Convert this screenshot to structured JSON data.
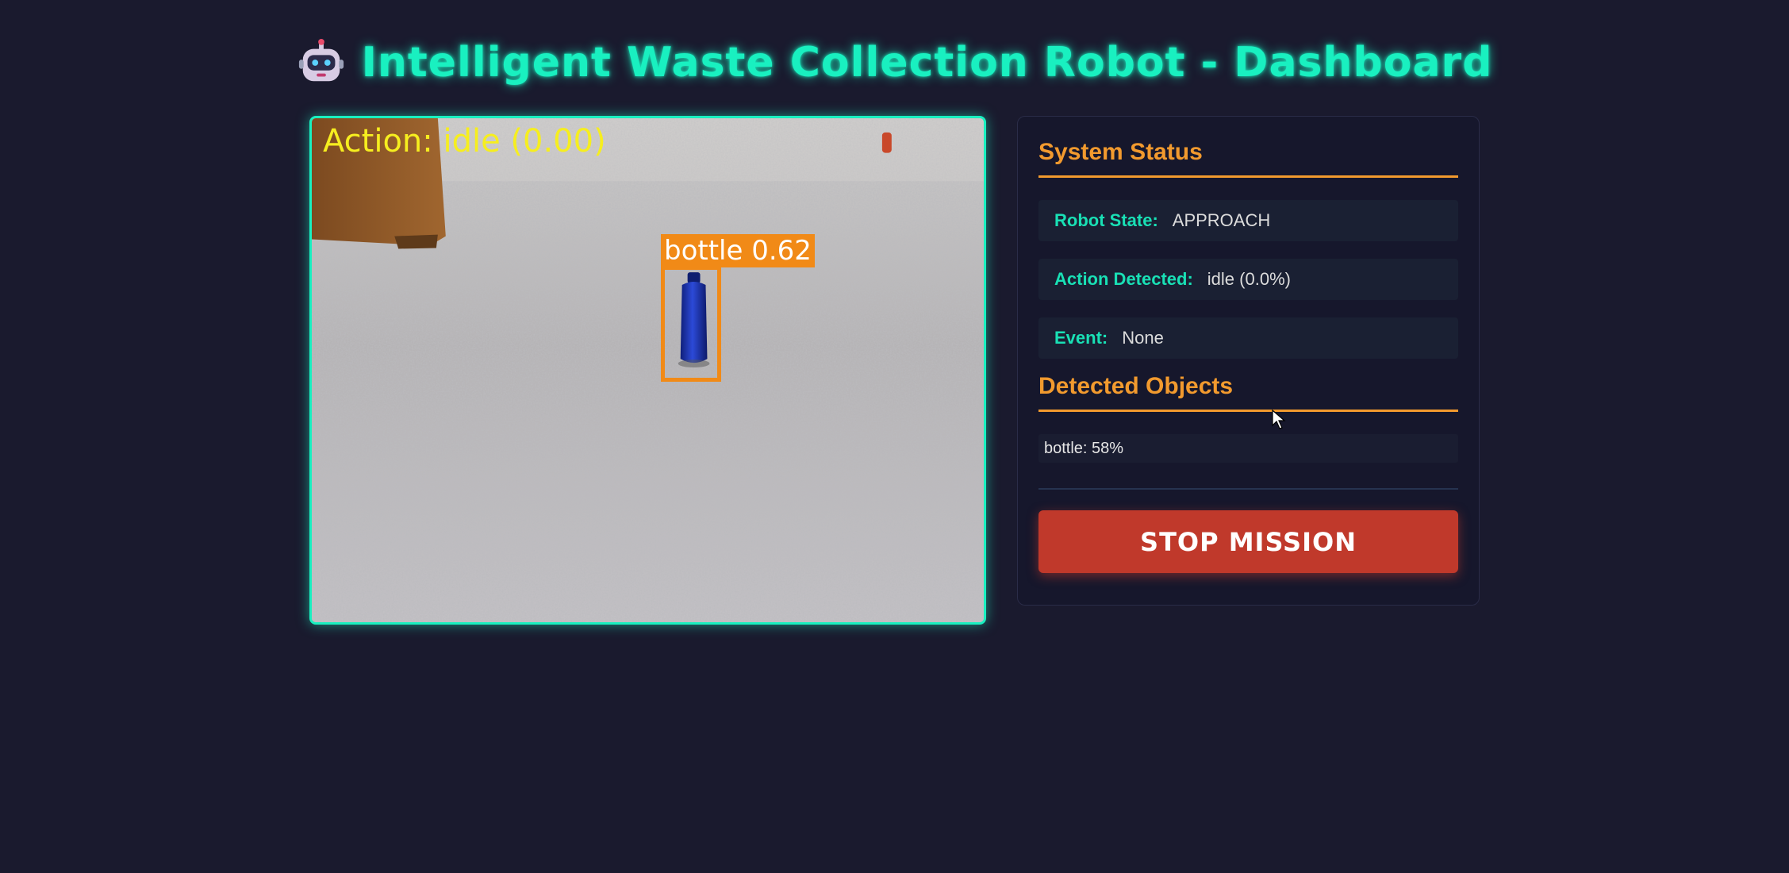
{
  "header": {
    "title": "Intelligent Waste Collection Robot - Dashboard",
    "icon": "robot-icon"
  },
  "video_feed": {
    "overlay_action_text": "Action: idle (0.00)",
    "detection_label": "bottle 0.62",
    "detection_color": "#f18a17"
  },
  "status_panel": {
    "system_status_title": "System Status",
    "rows": [
      {
        "label": "Robot State:",
        "value": "APPROACH"
      },
      {
        "label": "Action Detected:",
        "value": "idle (0.0%)"
      },
      {
        "label": "Event:",
        "value": "None"
      }
    ],
    "detected_objects_title": "Detected Objects",
    "objects": [
      "bottle: 58%"
    ],
    "stop_button_label": "STOP MISSION"
  },
  "colors": {
    "background": "#1a1a2e",
    "accent_teal": "#19f0c0",
    "accent_orange": "#f29a2e",
    "stop_red": "#c0392b"
  }
}
